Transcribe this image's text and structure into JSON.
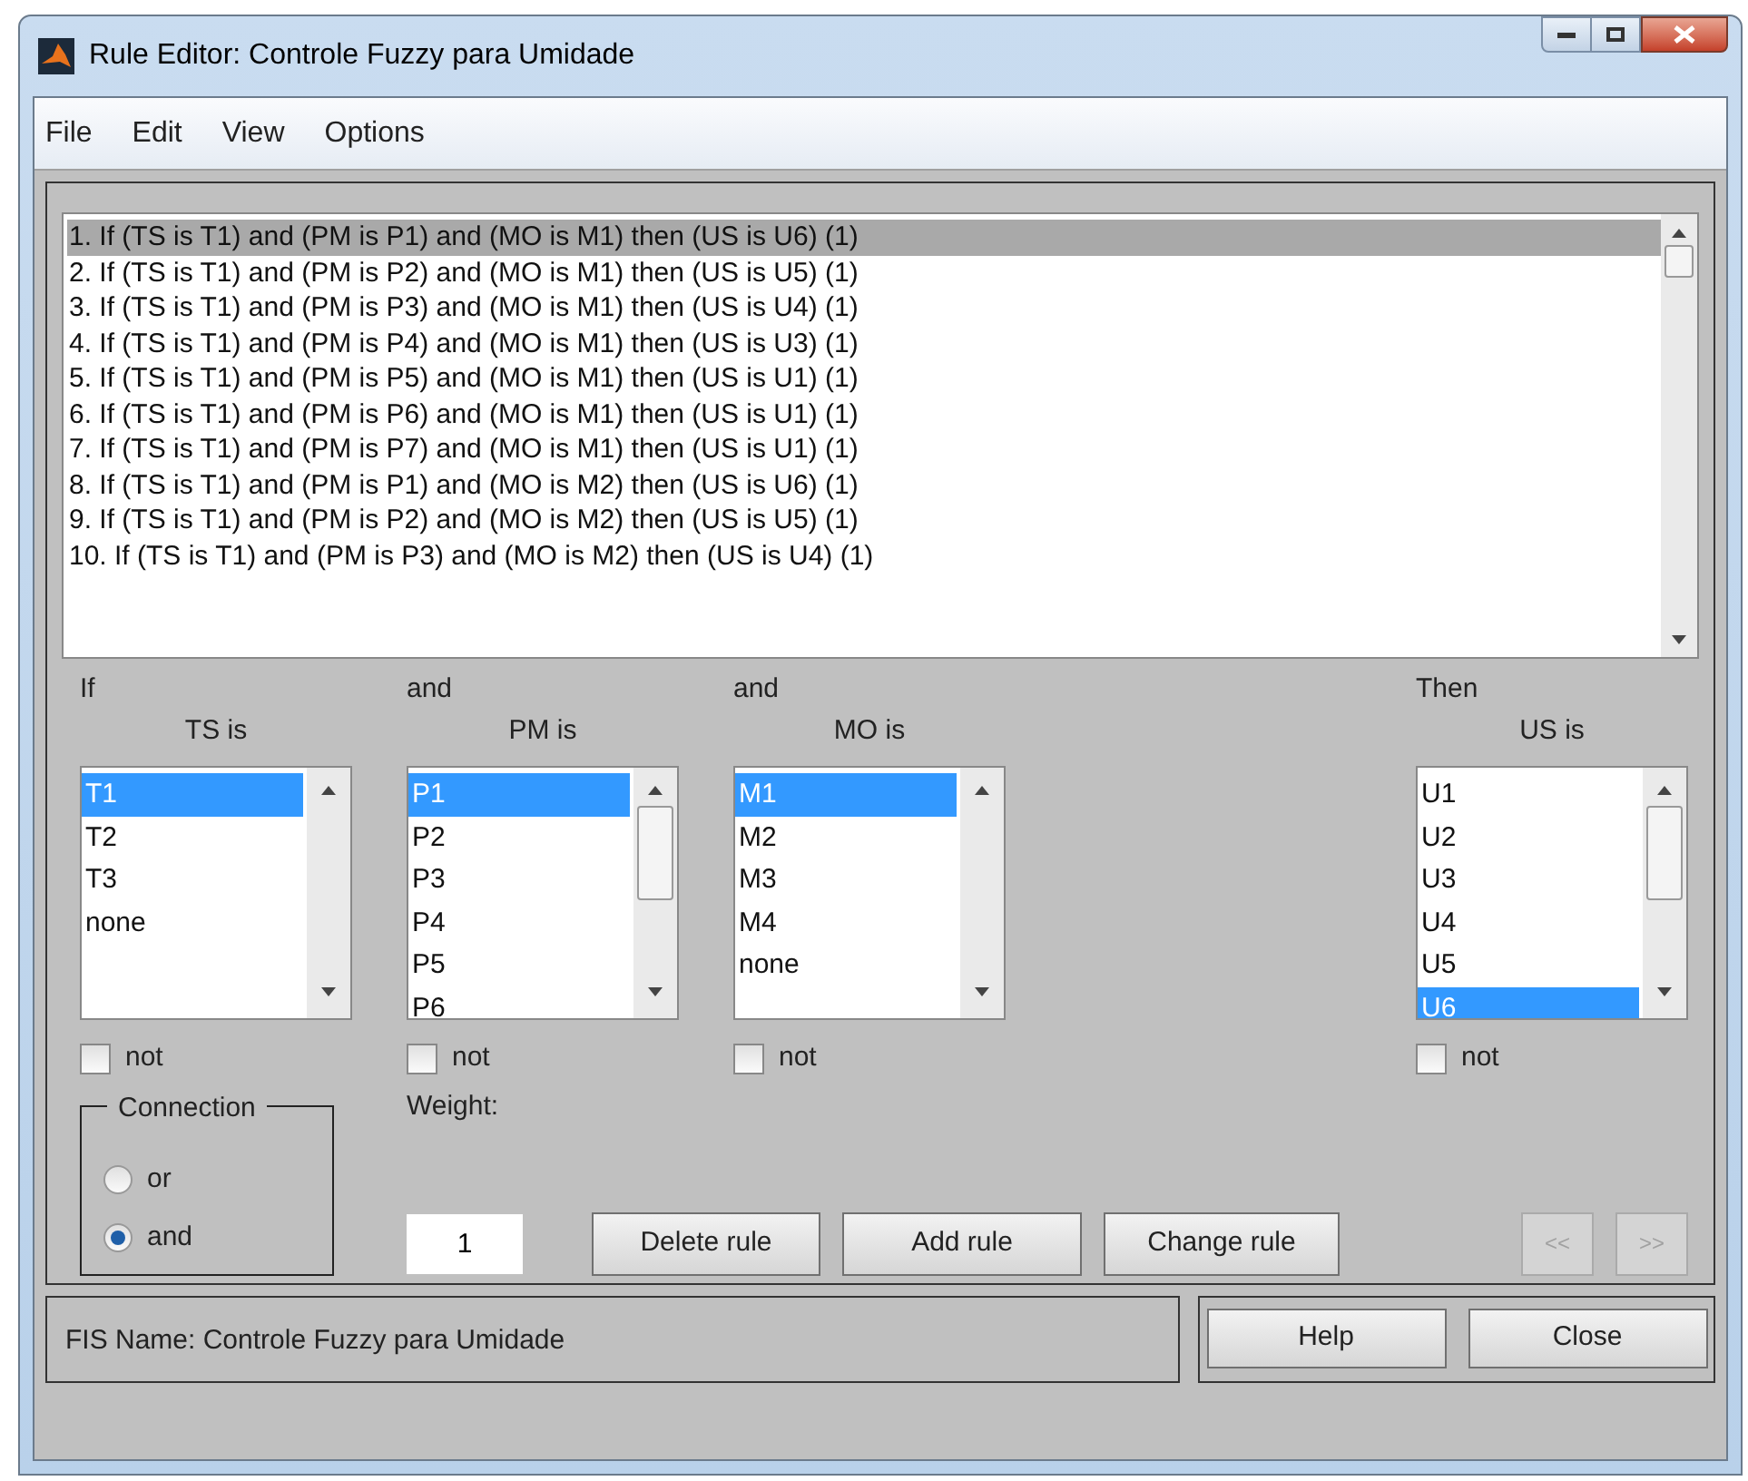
{
  "window": {
    "title": "Rule Editor: Controle Fuzzy para Umidade"
  },
  "menu": [
    "File",
    "Edit",
    "View",
    "Options"
  ],
  "rules": [
    {
      "text": "1. If (TS is T1) and (PM is P1) and (MO is M1) then (US is U6) (1)",
      "selected": true
    },
    {
      "text": "2. If (TS is T1) and (PM is P2) and (MO is M1) then (US is U5) (1)",
      "selected": false
    },
    {
      "text": "3. If (TS is T1) and (PM is P3) and (MO is M1) then (US is U4) (1)",
      "selected": false
    },
    {
      "text": "4. If (TS is T1) and (PM is P4) and (MO is M1) then (US is U3) (1)",
      "selected": false
    },
    {
      "text": "5. If (TS is T1) and (PM is P5) and (MO is M1) then (US is U1) (1)",
      "selected": false
    },
    {
      "text": "6. If (TS is T1) and (PM is P6) and (MO is M1) then (US is U1) (1)",
      "selected": false
    },
    {
      "text": "7. If (TS is T1) and (PM is P7) and (MO is M1) then (US is U1) (1)",
      "selected": false
    },
    {
      "text": "8. If (TS is T1) and (PM is P1) and (MO is M2) then (US is U6) (1)",
      "selected": false
    },
    {
      "text": "9. If (TS is T1) and (PM is P2) and (MO is M2) then (US is U5) (1)",
      "selected": false
    },
    {
      "text": "10. If (TS is T1) and (PM is P3) and (MO is M2) then (US is U4) (1)",
      "selected": false
    }
  ],
  "variables": [
    {
      "heading": "If",
      "label": "TS is",
      "not_label": "not",
      "not_checked": false,
      "items": [
        {
          "label": "T1",
          "selected": true
        },
        {
          "label": "T2",
          "selected": false
        },
        {
          "label": "T3",
          "selected": false
        },
        {
          "label": "none",
          "selected": false
        }
      ]
    },
    {
      "heading": "and",
      "label": "PM is",
      "not_label": "not",
      "not_checked": false,
      "items": [
        {
          "label": "P1",
          "selected": true
        },
        {
          "label": "P2",
          "selected": false
        },
        {
          "label": "P3",
          "selected": false
        },
        {
          "label": "P4",
          "selected": false
        },
        {
          "label": "P5",
          "selected": false
        },
        {
          "label": "P6",
          "selected": false
        }
      ]
    },
    {
      "heading": "and",
      "label": "MO is",
      "not_label": "not",
      "not_checked": false,
      "items": [
        {
          "label": "M1",
          "selected": true
        },
        {
          "label": "M2",
          "selected": false
        },
        {
          "label": "M3",
          "selected": false
        },
        {
          "label": "M4",
          "selected": false
        },
        {
          "label": "none",
          "selected": false
        }
      ]
    },
    {
      "heading": "Then",
      "label": "US is",
      "not_label": "not",
      "not_checked": false,
      "items": [
        {
          "label": "U1",
          "selected": false
        },
        {
          "label": "U2",
          "selected": false
        },
        {
          "label": "U3",
          "selected": false
        },
        {
          "label": "U4",
          "selected": false
        },
        {
          "label": "U5",
          "selected": false
        },
        {
          "label": "U6",
          "selected": true
        }
      ]
    }
  ],
  "connection": {
    "legend": "Connection",
    "options": [
      {
        "label": "or",
        "selected": false
      },
      {
        "label": "and",
        "selected": true
      }
    ]
  },
  "weight": {
    "label": "Weight:",
    "value": "1"
  },
  "buttons": [
    "Delete rule",
    "Add rule",
    "Change rule"
  ],
  "nav": [
    {
      "label": "<<",
      "disabled": true
    },
    {
      "label": ">>",
      "disabled": true
    }
  ],
  "status": "FIS Name: Controle Fuzzy para Umidade",
  "footer_buttons": [
    "Help",
    "Close"
  ]
}
